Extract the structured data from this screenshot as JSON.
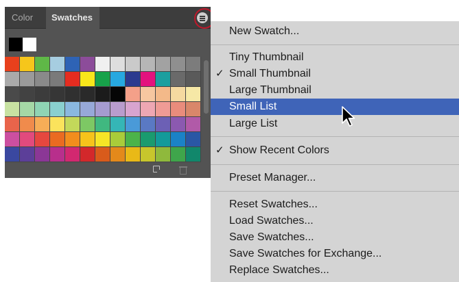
{
  "panel": {
    "tabs": [
      {
        "label": "Color"
      },
      {
        "label": "Swatches"
      }
    ],
    "menu_button_icon": "hamburger-menu-icon",
    "recent_colors": [
      "#000000",
      "#ffffff"
    ],
    "swatch_rows": [
      [
        "#e8401c",
        "#f6c61b",
        "#5fb847",
        "#a6cde0",
        "#2e63b5",
        "#8c4c9a",
        "#f0f0f0",
        "#dedede",
        "#cacaca",
        "#b6b6b6",
        "#a2a2a2",
        "#8f8f8f",
        "#7c7c7c"
      ],
      [
        "#aaaaaa",
        "#9a9a9a",
        "#8a8a8a",
        "#7a7a7a",
        "#e52c20",
        "#f8e71b",
        "#17a24a",
        "#27a8e0",
        "#2b3a8f",
        "#e3127e",
        "#1b9f9f",
        "#6a6a6a",
        "#5a5a5a"
      ],
      [
        "#4a4a4a",
        "#424242",
        "#3c3c3c",
        "#363636",
        "#303030",
        "#2a2a2a",
        "#1b1b1b",
        "#050505",
        "#f4a089",
        "#f6c7a0",
        "#f3b989",
        "#f5d9a0",
        "#f6e8a6"
      ],
      [
        "#c8e2a2",
        "#a5d8a6",
        "#8fd4b4",
        "#8ad0cf",
        "#8ab8e0",
        "#97a8d8",
        "#a59bd0",
        "#b99ccd",
        "#d8a4cf",
        "#eea7b3",
        "#ef9b95",
        "#e98c7c",
        "#d9876a"
      ],
      [
        "#e9644b",
        "#f08b4c",
        "#f6ad57",
        "#fbe35c",
        "#c3d85a",
        "#7dc864",
        "#40b880",
        "#35b6b6",
        "#4a9ad8",
        "#5a79c4",
        "#6c60b5",
        "#8b59b0",
        "#b15aa8"
      ],
      [
        "#cc4fa0",
        "#e24a7d",
        "#e6473f",
        "#ea6b21",
        "#f28d1d",
        "#f6c31b",
        "#f5e526",
        "#a9cc3a",
        "#4cb34a",
        "#1a9b6f",
        "#139a9a",
        "#1b82c7",
        "#2a57a5"
      ],
      [
        "#3a48a0",
        "#5c3f99",
        "#8b3796",
        "#b82f8c",
        "#d22870",
        "#d3282b",
        "#d95b1b",
        "#e3891b",
        "#e9b917",
        "#c7c62c",
        "#8fb93c",
        "#3fa54b",
        "#11876b"
      ]
    ],
    "footer_icons": [
      "new-swatch-icon",
      "trash-icon"
    ]
  },
  "menu": {
    "items": [
      {
        "label": "New Swatch...",
        "checked": false,
        "selected": false
      },
      {
        "label": "Tiny Thumbnail",
        "checked": false,
        "selected": false
      },
      {
        "label": "Small Thumbnail",
        "checked": true,
        "selected": false
      },
      {
        "label": "Large Thumbnail",
        "checked": false,
        "selected": false
      },
      {
        "label": "Small List",
        "checked": false,
        "selected": true
      },
      {
        "label": "Large List",
        "checked": false,
        "selected": false
      },
      {
        "label": "Show Recent Colors",
        "checked": true,
        "selected": false
      },
      {
        "label": "Preset Manager...",
        "checked": false,
        "selected": false
      },
      {
        "label": "Reset Swatches...",
        "checked": false,
        "selected": false
      },
      {
        "label": "Load Swatches...",
        "checked": false,
        "selected": false
      },
      {
        "label": "Save Swatches...",
        "checked": false,
        "selected": false
      },
      {
        "label": "Save Swatches for Exchange...",
        "checked": false,
        "selected": false
      },
      {
        "label": "Replace Swatches...",
        "checked": false,
        "selected": false
      }
    ],
    "check_glyph": "✓",
    "cursor_icon": "arrow-cursor-icon"
  },
  "colors": {
    "panel_bg": "#535353",
    "tabbar_bg": "#3d3d3d",
    "menu_bg": "#d4d4d4",
    "selection": "#3f64b8",
    "highlight_ring": "#c0182b"
  }
}
